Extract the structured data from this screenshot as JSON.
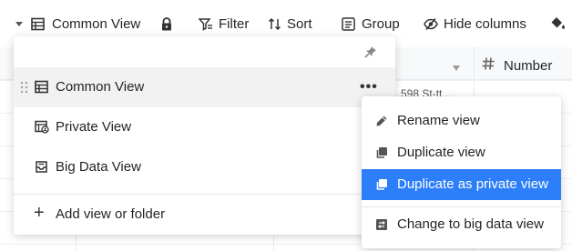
{
  "toolbar": {
    "view_name": "Common View",
    "filter_label": "Filter",
    "sort_label": "Sort",
    "group_label": "Group",
    "hide_columns_label": "Hide columns"
  },
  "grid": {
    "number_column_label": "Number",
    "peek_text": "...598 St-tt..."
  },
  "views_menu": {
    "items": [
      {
        "label": "Common View",
        "icon": "table-icon",
        "selected": true
      },
      {
        "label": "Private View",
        "icon": "private-view-icon",
        "selected": false
      },
      {
        "label": "Big Data View",
        "icon": "big-data-icon",
        "selected": false
      }
    ],
    "add_label": "Add view or folder"
  },
  "context_menu": {
    "items": [
      {
        "label": "Rename view",
        "icon": "pencil-icon"
      },
      {
        "label": "Duplicate view",
        "icon": "duplicate-icon"
      },
      {
        "label": "Duplicate as private view",
        "icon": "duplicate-icon",
        "active": true
      },
      {
        "label": "Change to big data view",
        "icon": "convert-icon"
      }
    ]
  },
  "colors": {
    "accent": "#2d7ff9",
    "text": "#212529",
    "selected_bg": "#f2f2f2"
  }
}
